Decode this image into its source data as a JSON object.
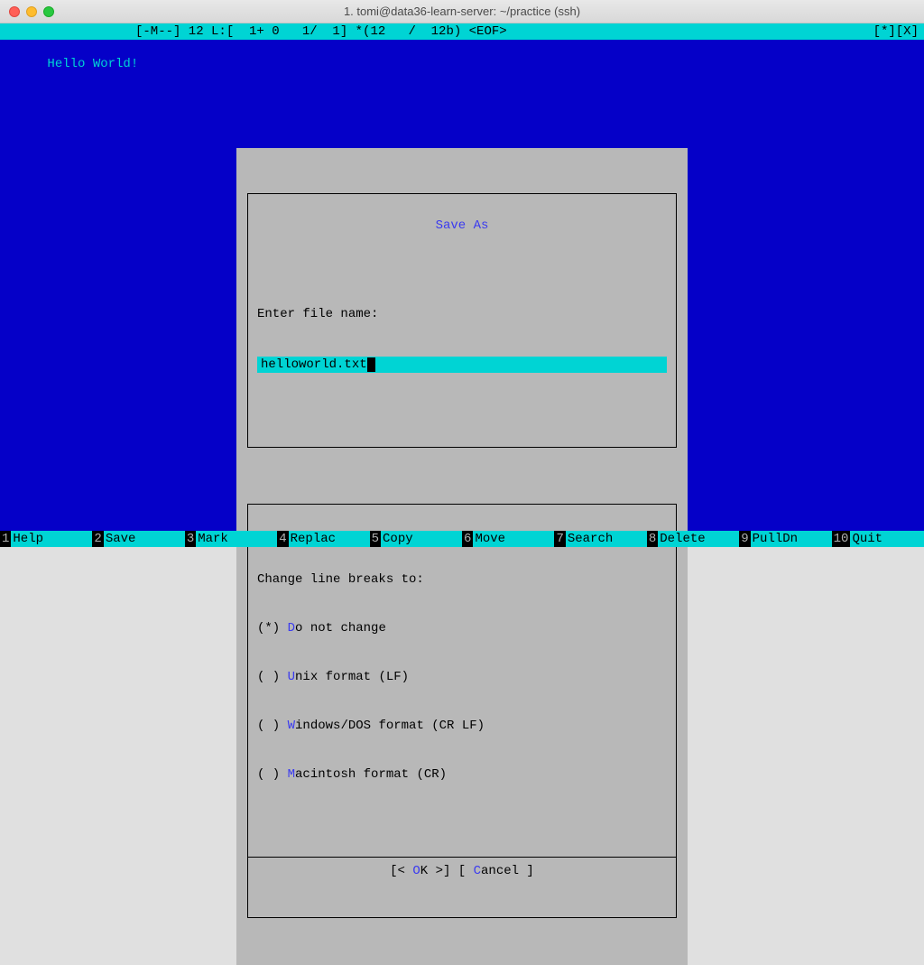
{
  "titlebar": {
    "title": "1. tomi@data36-learn-server: ~/practice (ssh)"
  },
  "statusbar": {
    "left": "[-M--] 12 L:[  1+ 0   1/  1] *(12   /  12b) <EOF>",
    "right": "[*][X]"
  },
  "editor": {
    "content": "Hello World!"
  },
  "dialog": {
    "title": "Save As",
    "prompt": "Enter file name:",
    "filename": "helloworld.txt",
    "section_label": "Change line breaks to:",
    "options": [
      {
        "marker": "(*)",
        "hotkey": "D",
        "rest": "o not change"
      },
      {
        "marker": "( )",
        "hotkey": "U",
        "rest": "nix format (LF)"
      },
      {
        "marker": "( )",
        "hotkey": "W",
        "rest": "indows/DOS format (CR LF)"
      },
      {
        "marker": "( )",
        "hotkey": "M",
        "rest": "acintosh format (CR)"
      }
    ],
    "ok_pre": "[< ",
    "ok_hot": "O",
    "ok_post": "K >]",
    "cancel_pre": "[ ",
    "cancel_hot": "C",
    "cancel_post": "ancel ]"
  },
  "fnkeys": [
    {
      "num": "1",
      "label": "Help"
    },
    {
      "num": "2",
      "label": "Save"
    },
    {
      "num": "3",
      "label": "Mark"
    },
    {
      "num": "4",
      "label": "Replac"
    },
    {
      "num": "5",
      "label": "Copy"
    },
    {
      "num": "6",
      "label": "Move"
    },
    {
      "num": "7",
      "label": "Search"
    },
    {
      "num": "8",
      "label": "Delete"
    },
    {
      "num": "9",
      "label": "PullDn"
    },
    {
      "num": "10",
      "label": "Quit"
    }
  ]
}
